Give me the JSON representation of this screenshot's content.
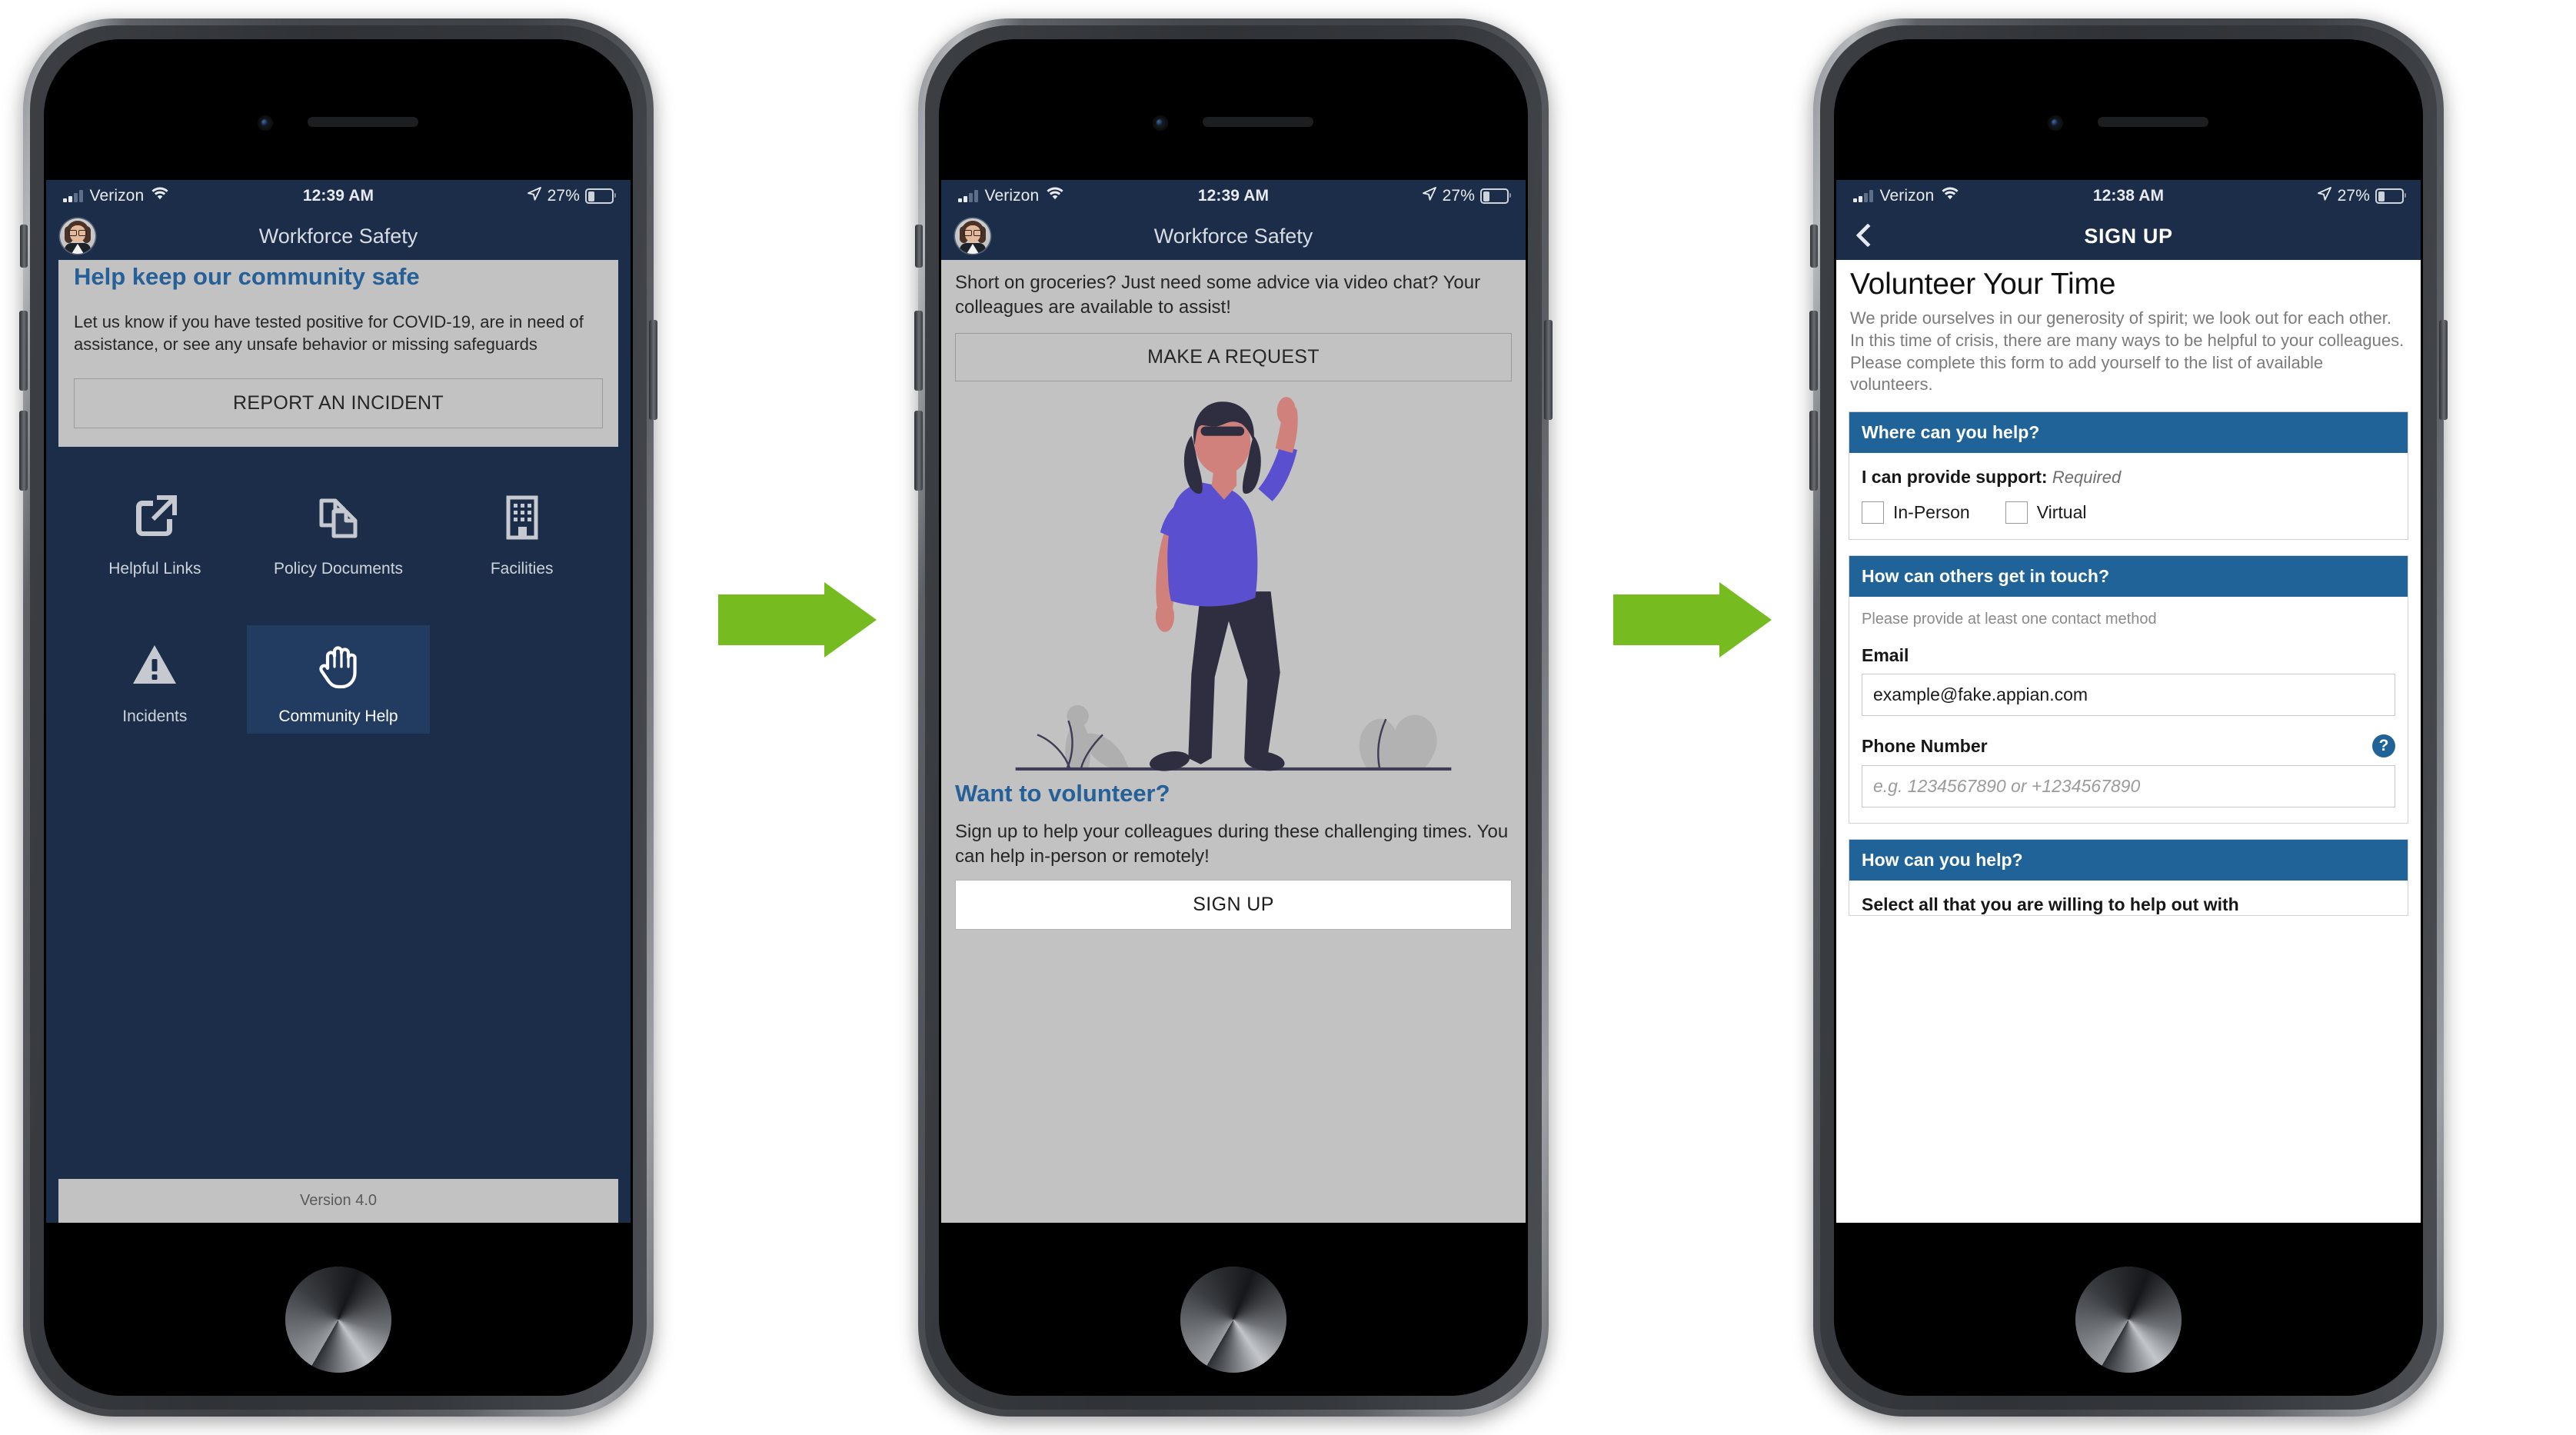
{
  "colors": {
    "header_navy": "#1b2d49",
    "accent_blue": "#256098",
    "section_blue": "#1f6399",
    "arrow_green": "#76bc21",
    "card_grey": "#c2c2c2",
    "active_tile": "#223b60"
  },
  "screen1": {
    "status": {
      "carrier": "Verizon",
      "time": "12:39 AM",
      "battery_pct": "27%",
      "signal_icon": "cellular-signal-icon",
      "wifi_icon": "wifi-icon",
      "location_icon": "location-arrow-icon",
      "battery_icon": "battery-icon"
    },
    "app_title": "Workforce Safety",
    "avatar_icon": "user-avatar",
    "card": {
      "title": "Help keep our community safe",
      "body": "Let us know if you have tested positive for COVID-19, are in need of assistance, or see any unsafe behavior or missing safeguards",
      "button": "REPORT AN INCIDENT"
    },
    "tiles": [
      {
        "label": "Helpful Links",
        "icon": "external-link-icon",
        "active": false
      },
      {
        "label": "Policy Documents",
        "icon": "documents-icon",
        "active": false
      },
      {
        "label": "Facilities",
        "icon": "building-icon",
        "active": false
      },
      {
        "label": "Incidents",
        "icon": "warning-triangle-icon",
        "active": false
      },
      {
        "label": "Community Help",
        "icon": "raised-hand-icon",
        "active": true
      }
    ],
    "version": "Version 4.0"
  },
  "screen2": {
    "status": {
      "carrier": "Verizon",
      "time": "12:39 AM",
      "battery_pct": "27%"
    },
    "app_title": "Workforce Safety",
    "lead": "Short on groceries? Just need some advice via video chat? Your colleagues are available to assist!",
    "request_button": "MAKE A REQUEST",
    "illustration": "woman-raising-hand-illustration",
    "volunteer_heading": "Want to volunteer?",
    "volunteer_body": "Sign up to help your colleagues during these challenging times. You can help in-person or remotely!",
    "signup_button": "SIGN UP"
  },
  "screen3": {
    "status": {
      "carrier": "Verizon",
      "time": "12:38 AM",
      "battery_pct": "27%"
    },
    "back_icon": "chevron-left-icon",
    "nav_title": "SIGN UP",
    "page_title": "Volunteer Your Time",
    "page_body": "We pride ourselves in our generosity of spirit; we look out for each other. In this time of crisis, there are many ways to be helpful to your colleagues. Please complete this form to add yourself to the list of available volunteers.",
    "section_where": {
      "heading": "Where can you help?",
      "field_label": "I can provide support:",
      "required_text": "Required",
      "options": [
        "In-Person",
        "Virtual"
      ]
    },
    "section_touch": {
      "heading": "How can others get in touch?",
      "hint": "Please provide at least one contact method",
      "email_label": "Email",
      "email_value": "example@fake.appian.com",
      "phone_label": "Phone Number",
      "phone_placeholder": "e.g. 1234567890 or +1234567890",
      "help_icon": "help-question-icon",
      "help_glyph": "?"
    },
    "section_how": {
      "heading": "How can you help?",
      "select_label": "Select all that you are willing to help out with"
    }
  },
  "flow": {
    "arrow1": "green-right-arrow",
    "arrow2": "green-right-arrow"
  }
}
